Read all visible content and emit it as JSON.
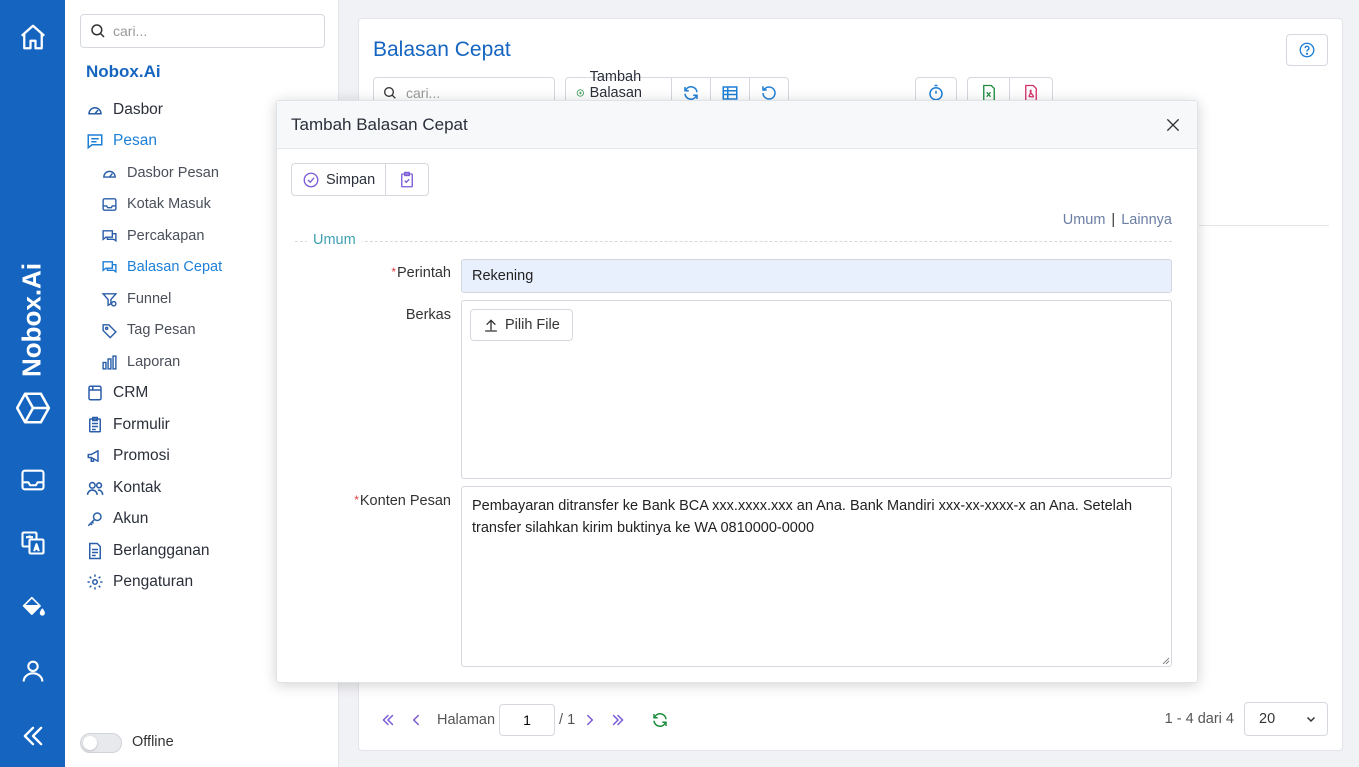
{
  "rail": {
    "brand": "Nobox.Ai"
  },
  "sidebar": {
    "search_placeholder": "cari...",
    "brand_title": "Nobox.Ai",
    "items": [
      {
        "label": "Dasbor"
      },
      {
        "label": "Pesan"
      },
      {
        "label": "Dasbor Pesan"
      },
      {
        "label": "Kotak Masuk"
      },
      {
        "label": "Percakapan"
      },
      {
        "label": "Balasan Cepat"
      },
      {
        "label": "Funnel"
      },
      {
        "label": "Tag Pesan"
      },
      {
        "label": "Laporan"
      },
      {
        "label": "CRM"
      },
      {
        "label": "Formulir"
      },
      {
        "label": "Promosi"
      },
      {
        "label": "Kontak"
      },
      {
        "label": "Akun"
      },
      {
        "label": "Berlangganan"
      },
      {
        "label": "Pengaturan"
      }
    ],
    "status_label": "Offline"
  },
  "main": {
    "title": "Balasan Cepat",
    "search_placeholder": "cari...",
    "add_label": "Tambah Balasan Cepat",
    "pager": {
      "page_label": "Halaman",
      "page": "1",
      "total": "/ 1",
      "count": "1 - 4 dari 4",
      "page_size": "20"
    }
  },
  "modal": {
    "title": "Tambah Balasan Cepat",
    "save_label": "Simpan",
    "tab_umum": "Umum",
    "tab_sep": "|",
    "tab_lainnya": "Lainnya",
    "section": "Umum",
    "perintah_label": "Perintah",
    "perintah_value": "Rekening",
    "berkas_label": "Berkas",
    "file_button": "Pilih File",
    "konten_label": "Konten Pesan",
    "konten_value": "Pembayaran ditransfer ke Bank BCA xxx.xxxx.xxx an Ana. Bank Mandiri xxx-xx-xxxx-x an Ana. Setelah transfer silahkan kirim buktinya ke WA 0810000-0000",
    "required_mark": "*"
  },
  "colors": {
    "rail": "#1565c0",
    "accent": "#1e7fd6",
    "section": "#3fa0b0",
    "excel": "#1e8e3e",
    "pdf": "#d6336c",
    "purple": "#7b5cd6"
  }
}
